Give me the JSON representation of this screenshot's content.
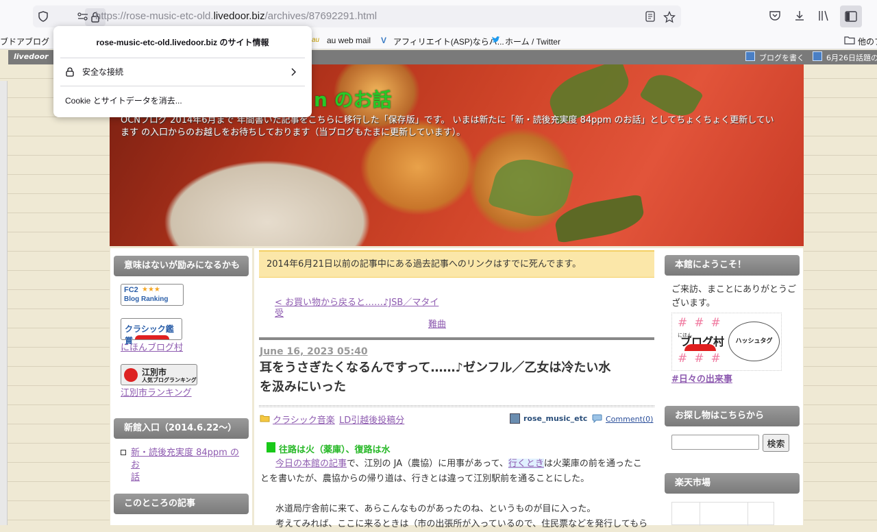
{
  "browser": {
    "url_prefix": "https://rose-music-etc-old.",
    "url_domain": "livedoor.biz",
    "url_suffix": "/archives/87692291.html"
  },
  "bookmarks": [
    {
      "label": "ブドアブログ（liv"
    },
    {
      "label": "au web mail"
    },
    {
      "label": "アフィリエイト(ASP)ならバ..."
    },
    {
      "label": "ホーム / Twitter"
    },
    {
      "label": "他のブ"
    }
  ],
  "popup": {
    "title": "rose-music-etc-old.livedoor.biz のサイト情報",
    "secure_label": "安全な接続",
    "cookie_label": "Cookie とサイトデータを消去..."
  },
  "ldbar": {
    "logo": "livedoor",
    "write_label": "ブログを書く",
    "topic_label": "6月26日話題の"
  },
  "header": {
    "title_visible": "n のお話",
    "desc_line1": "OCNブログ        2014年6月まで    年間書いた記事をこちらに移行した「保存版」です。 いまは新たに「新・読後充実度 84ppm のお話」としてちょくちょく更新してい",
    "desc_line2": "ます        の入口からのお越しをお待ちしております（当ブログもたまに更新しています）。"
  },
  "left": {
    "box1_title": "意味はないが励みになるかも",
    "fc2_line1": "FC2",
    "fc2_line2": "Blog Ranking",
    "classic_badge": "クラシック鑑賞",
    "nihon_link": "にほんブログ村",
    "ebetsu_badge_line1": "江別市",
    "ebetsu_badge_line2": "人気ブログランキング",
    "ebetsu_link": "江別市ランキング",
    "box2_title": "新館入口（2014.6.22〜）",
    "new_link_line1": "新・読後充実度 84ppm のお",
    "new_link_line2": "話",
    "box3_title": "このところの記事"
  },
  "center": {
    "notice": "2014年6月21日以前の記事中にある過去記事へのリンクはすでに死んでます。",
    "prev_line1": "< お買い物から戻ると……♪JSB／マタイ受",
    "prev_line2": "難曲",
    "date": "June 16, 2023 05:40",
    "title_line1": "耳をうさぎたくなるんですって……♪ゼンフル／乙女は冷たい水",
    "title_line2": "を汲みにいった",
    "cat1": "クラシック音楽",
    "cat2": "LD引越後投稿分",
    "author": "rose_music_etc",
    "comment": "Comment(0)",
    "heading": "往路は火（薬庫）、復路は水",
    "p1_link1": "今日の本館の記事",
    "p1_a": "で、江別の JA（農協）に用事があって、",
    "p1_link2": "行くとき",
    "p1_b": "は火薬庫の前を通ったこ",
    "p1_line2": "とを書いたが、農協からの帰り道は、行きとは違って江別駅前を通ることにした。",
    "p2": "水道局庁舎前に来て、あらこんなものがあったのね、というものが目に入った。",
    "p3": "考えてみれば、ここに来るときは（市の出張所が入っているので、住民票などを発行してもら"
  },
  "right": {
    "box1_title": "本館にようこそ！",
    "welcome_line1": "ご来訪、まことにありがとうご",
    "welcome_line2": "ざいます。",
    "village_label": "ブログ村",
    "village_small": "にほん",
    "hashtag_label": "ハッシュタグ",
    "hash_link": "#日々の出来事",
    "box2_title": "お探し物はこちらから",
    "search_button": "検索",
    "box3_title": "楽天市場"
  },
  "colors": {
    "notice_bg": "#fbe7a9",
    "link": "#8e5bb0",
    "header_title": "#27c927",
    "box_title_bg": "#7a7a7a"
  }
}
